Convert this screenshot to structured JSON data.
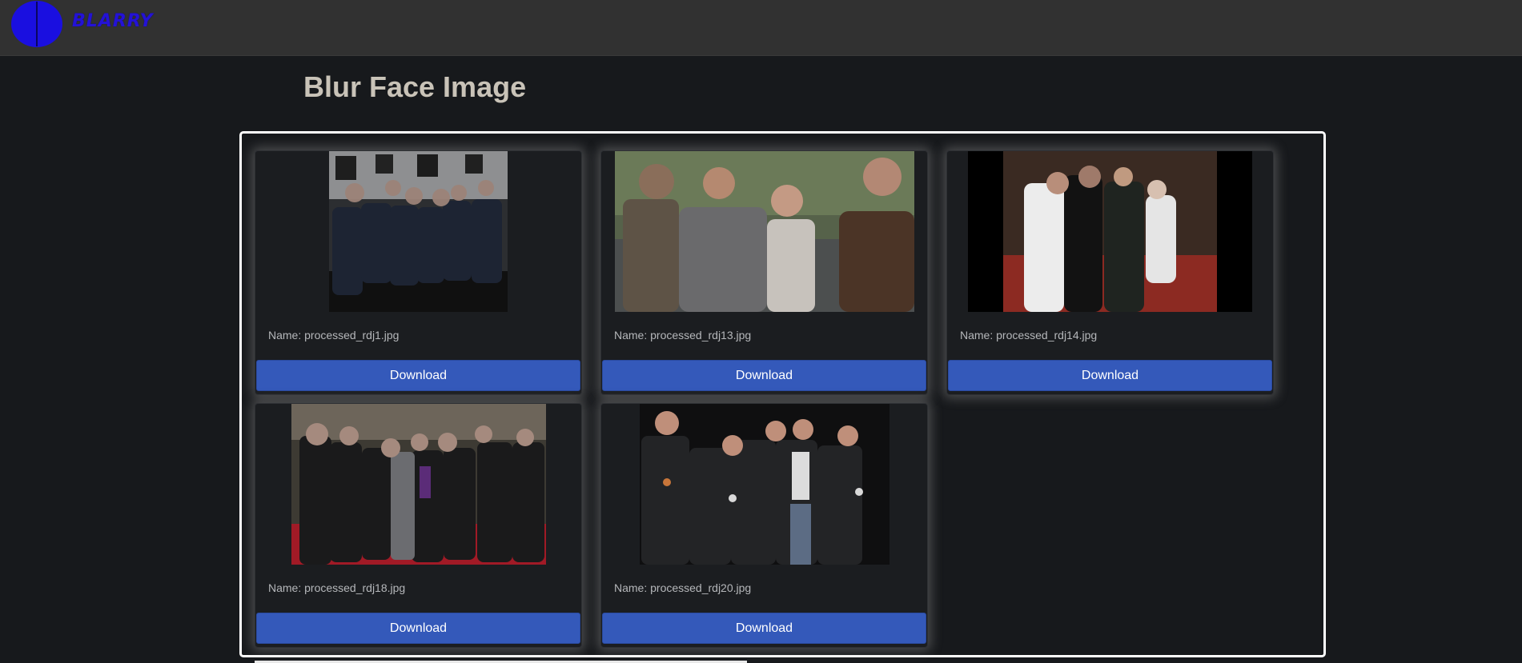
{
  "navbar": {
    "brand": "BLARRY",
    "logo_icon": "blue-circle-logo-icon",
    "logo_color": "#1a0fe0",
    "background": "#313131"
  },
  "page": {
    "title": "Blur Face Image"
  },
  "gallery": {
    "cards": [
      {
        "name_label": "Name: processed_rdj1.jpg",
        "button_label": "Download"
      },
      {
        "name_label": "Name: processed_rdj13.jpg",
        "button_label": "Download"
      },
      {
        "name_label": "Name: processed_rdj14.jpg",
        "button_label": "Download"
      },
      {
        "name_label": "Name: processed_rdj18.jpg",
        "button_label": "Download"
      },
      {
        "name_label": "Name: processed_rdj20.jpg",
        "button_label": "Download"
      }
    ]
  },
  "colors": {
    "accent": "#3459ba",
    "page_bg": "#17191c",
    "card_bg": "#1b1d20",
    "title": "#c9c3b8"
  }
}
